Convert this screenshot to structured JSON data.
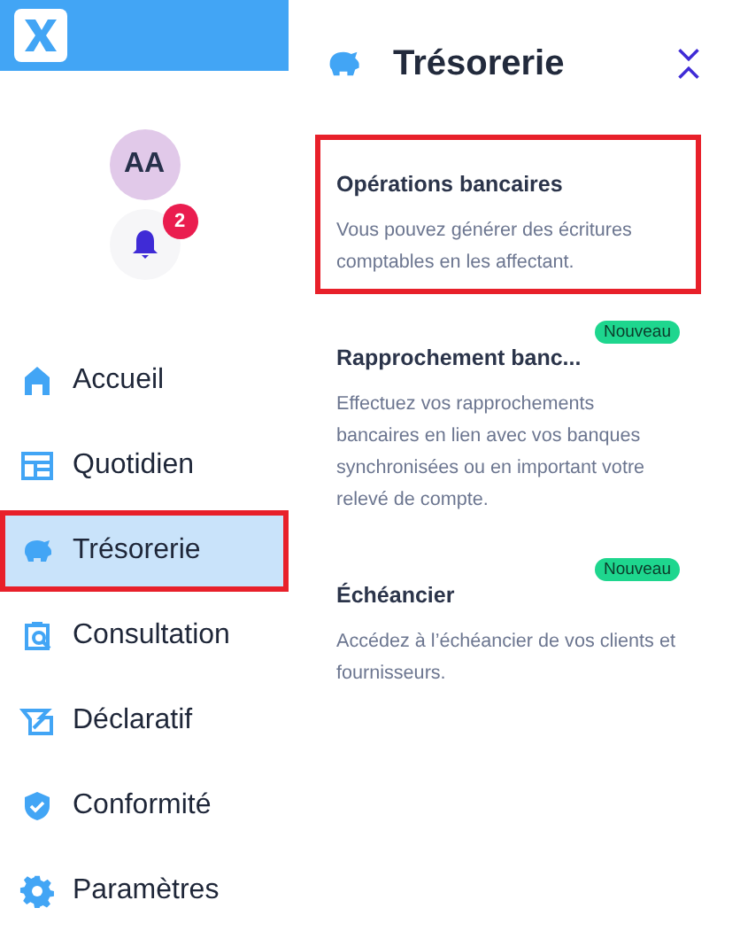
{
  "user": {
    "initials": "AA"
  },
  "notifications": {
    "count": "2"
  },
  "nav": [
    {
      "label": "Accueil",
      "selected": false
    },
    {
      "label": "Quotidien",
      "selected": false
    },
    {
      "label": "Trésorerie",
      "selected": true
    },
    {
      "label": "Consultation",
      "selected": false
    },
    {
      "label": "Déclaratif",
      "selected": false
    },
    {
      "label": "Conformité",
      "selected": false
    },
    {
      "label": "Paramètres",
      "selected": false
    }
  ],
  "panel": {
    "title": "Trésorerie",
    "items": [
      {
        "title": "Opérations bancaires",
        "description": "Vous pouvez générer des écritures comptables en les affectant.",
        "selected": true
      },
      {
        "title": "Rapprochement banc...",
        "badge": "Nouveau",
        "description": "Effectuez vos rapprochements bancaires en lien avec vos banques synchronisées ou en important votre relevé de compte.",
        "selected": false
      },
      {
        "title": "Échéancier",
        "badge": "Nouveau",
        "description": "Accédez à l’échéancier de vos clients et fournisseurs.",
        "selected": false
      }
    ]
  }
}
